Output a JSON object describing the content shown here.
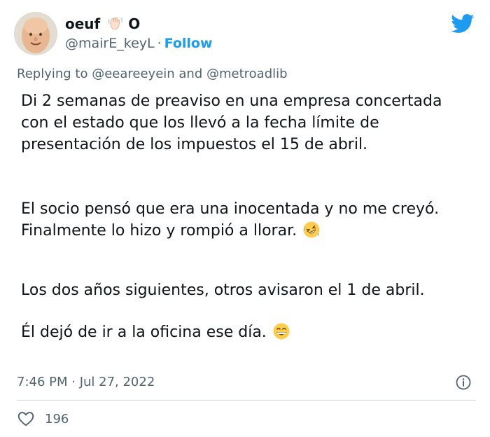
{
  "author": {
    "display_name": "oeuf",
    "name_suffix": "O",
    "handle": "@mairE_keyL",
    "separator": "·",
    "follow_label": "Follow",
    "avatar_icon": "cartoon-face-avatar",
    "name_icon": "waving-hand-emoji"
  },
  "reply": {
    "prefix": "Replying to ",
    "mention_1": "@eeareeyein",
    "conjunction": " and ",
    "mention_2": "@metroadlib"
  },
  "tweet": {
    "paragraph_1": "Di 2 semanas de preaviso en una empresa concertada\ncon el estado que los llevó a la fecha límite de\npresentación de los impuestos el 15 de abril.",
    "paragraph_2": "El socio pensó que era una inocentada y no me creyó.\nFinalmente lo hizo y rompió a llorar.",
    "paragraph_2_emoji": "rolling-on-floor-laughing-emoji",
    "paragraph_3": "Los dos años siguientes, otros avisaron el 1 de abril.",
    "paragraph_4": "Él dejó de ir a la oficina ese día.",
    "paragraph_4_emoji": "grinning-face-emoji"
  },
  "meta": {
    "timestamp": "7:46 PM · Jul 27, 2022",
    "info_icon": "info-icon"
  },
  "actions": {
    "like_count": "196",
    "like_icon": "heart-icon"
  },
  "colors": {
    "brand_blue": "#1d9bf0",
    "secondary_text": "#536471",
    "primary_text": "#0f1419",
    "divider": "#cfd9de"
  }
}
